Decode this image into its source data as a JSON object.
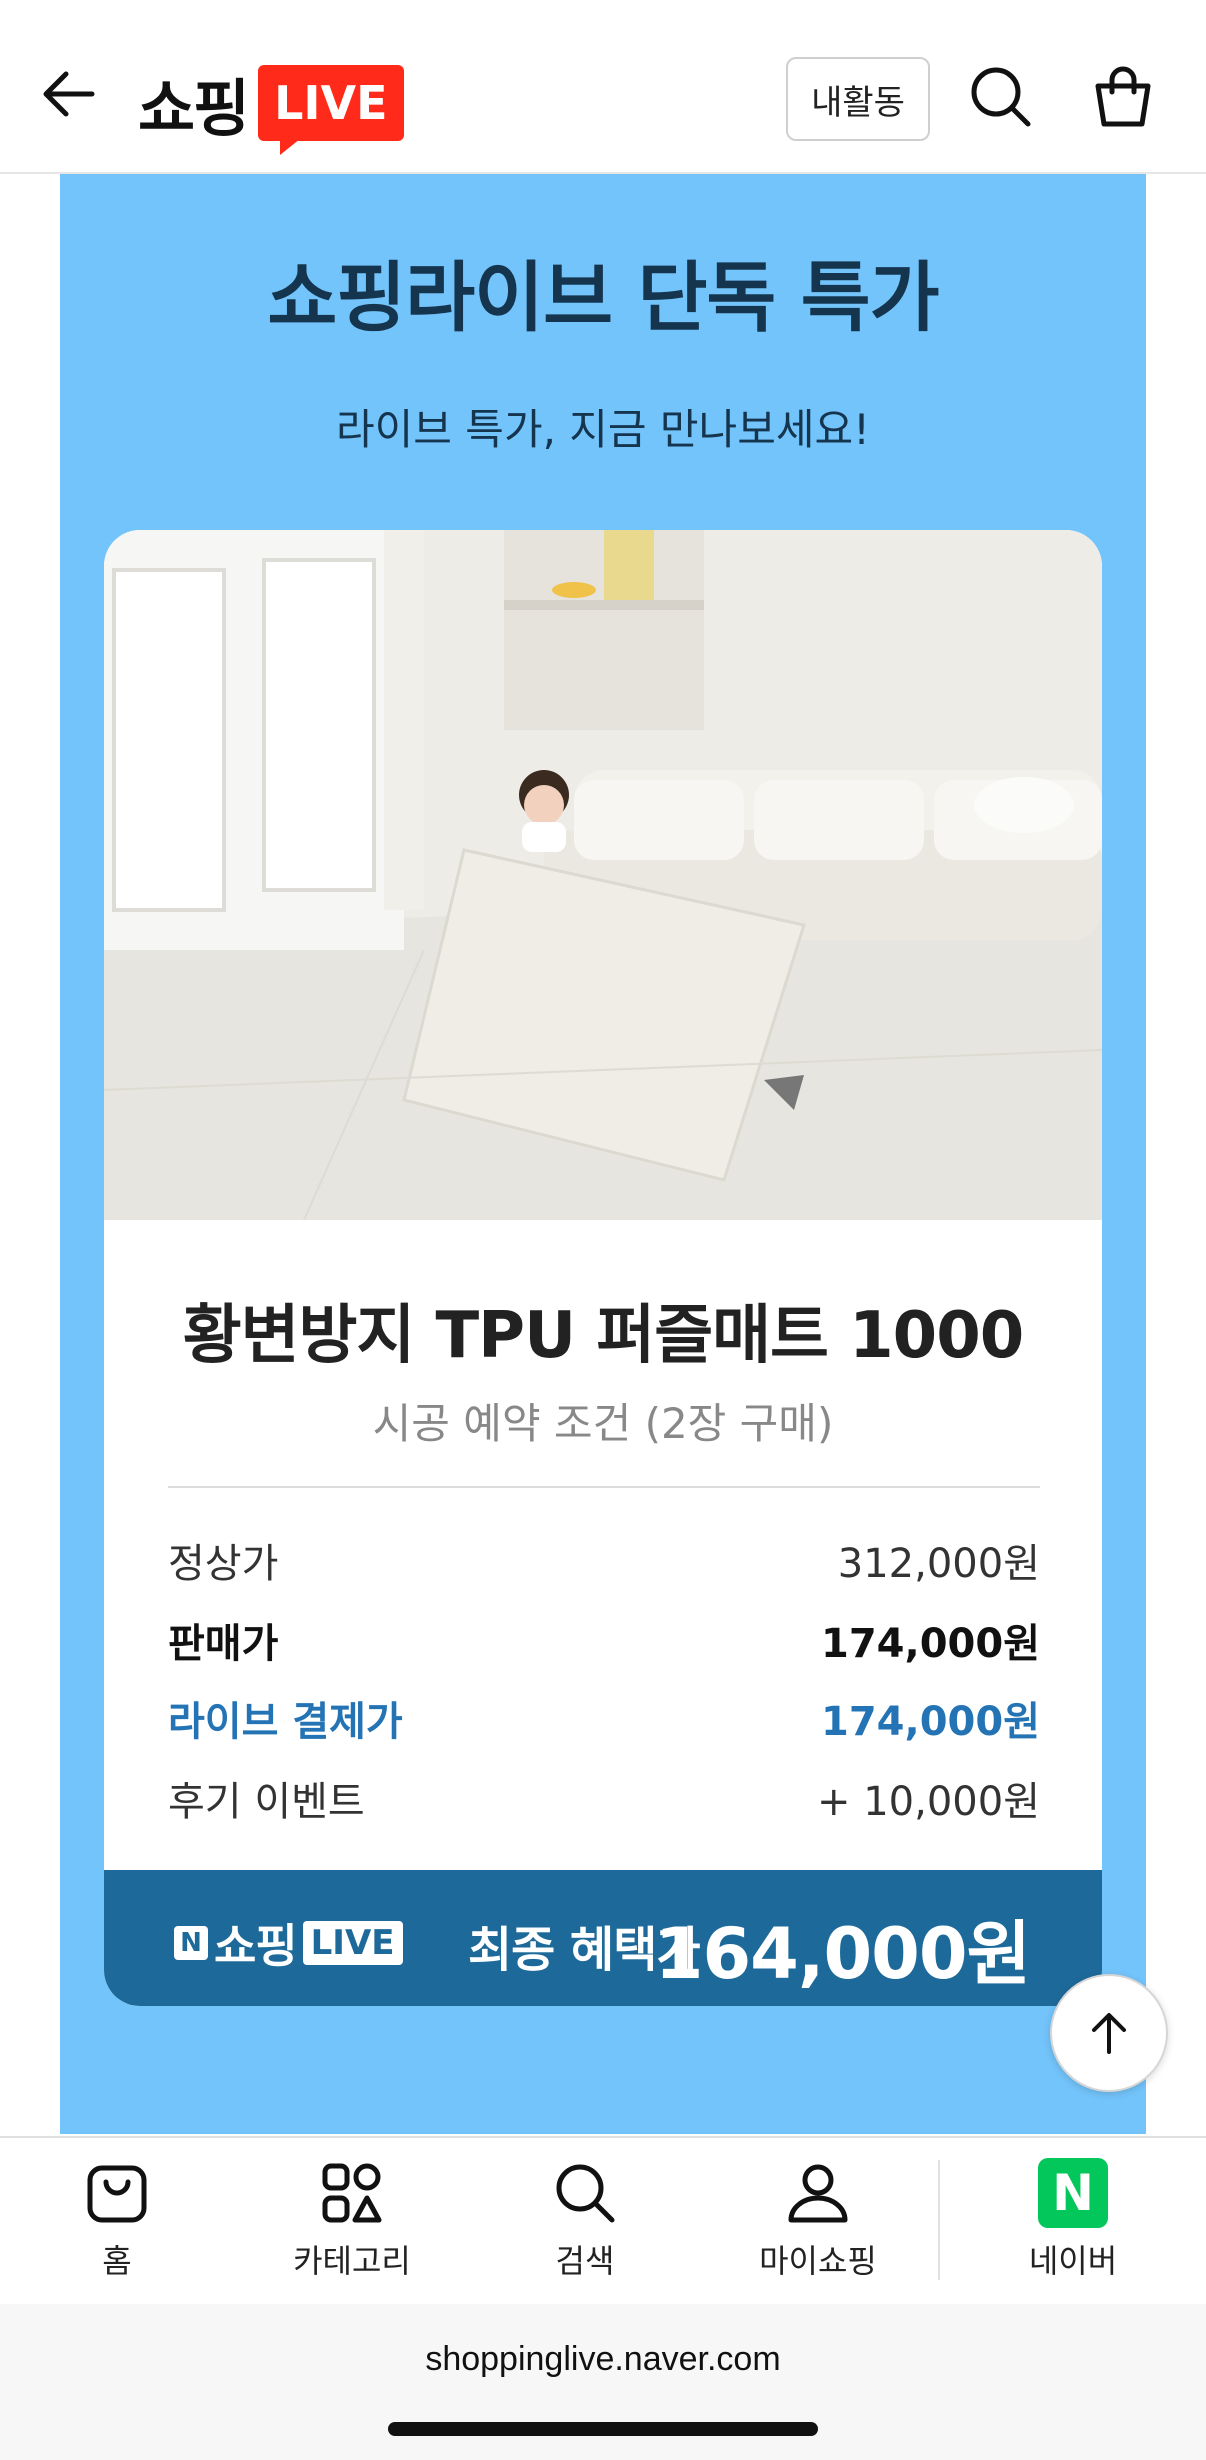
{
  "header": {
    "logo_text": "쇼핑",
    "logo_live": "LIVE",
    "activity_label": "내활동"
  },
  "banner": {
    "title": "쇼핑라이브 단독 특가",
    "subtitle": "라이브 특가, 지금 만나보세요!",
    "background_color": "#73c4fb"
  },
  "product": {
    "name": "황변방지 TPU 퍼즐매트 1000",
    "condition": "시공 예약 조건 (2장 구매)",
    "prices": [
      {
        "label": "정상가",
        "value": "312,000원"
      },
      {
        "label": "판매가",
        "value": "174,000원"
      },
      {
        "label": "라이브 결제가",
        "value": "174,000원"
      },
      {
        "label": "후기 이벤트",
        "value": "+ 10,000원"
      }
    ],
    "footer": {
      "brand_n": "N",
      "brand_shop": "쇼핑",
      "brand_live": "LIVE",
      "final_label": "최종 혜택가",
      "final_price": "164,000원",
      "color": "#1d6a9a"
    }
  },
  "bottom_nav": {
    "items": [
      {
        "label": "홈",
        "icon": "shopping-bag-icon"
      },
      {
        "label": "카테고리",
        "icon": "category-grid-icon"
      },
      {
        "label": "검색",
        "icon": "search-icon"
      },
      {
        "label": "마이쇼핑",
        "icon": "person-icon"
      },
      {
        "label": "네이버",
        "icon": "naver-n-icon"
      }
    ],
    "naver_letter": "N"
  },
  "browser": {
    "url": "shoppinglive.naver.com"
  }
}
